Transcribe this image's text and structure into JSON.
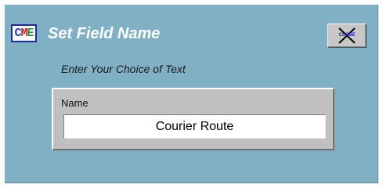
{
  "dialog": {
    "logo": {
      "c": "C",
      "m": "M",
      "e": "E"
    },
    "title": "Set Field Name",
    "close_button": {
      "label": "CLOSE",
      "icon": "close-x-icon"
    },
    "subtitle": "Enter Your Choice of Text",
    "field": {
      "label": "Name",
      "value": "Courier Route"
    }
  },
  "colors": {
    "dialog_background": "#7fb0c3",
    "panel_background": "#c0c0c0",
    "title_text": "#ffffff",
    "close_text": "#1a1ad0",
    "logo_c": "#2233b8",
    "logo_m": "#cc1a1a",
    "logo_e": "#1a9a33"
  }
}
